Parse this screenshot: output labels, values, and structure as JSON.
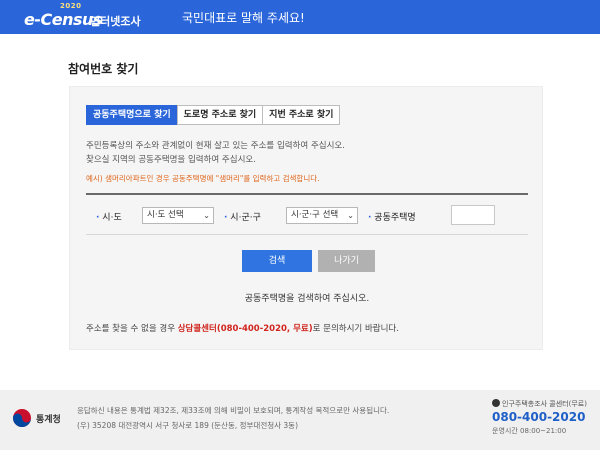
{
  "header": {
    "logo_year": "2020",
    "logo_main": "e-Census",
    "logo_sub": "인터넷조사",
    "slogan": "국민대표로 말해 주세요!"
  },
  "page": {
    "title": "참여번호 찾기"
  },
  "tabs": [
    {
      "label": "공동주택명으로 찾기",
      "active": true
    },
    {
      "label": "도로명 주소로 찾기",
      "active": false
    },
    {
      "label": "지번 주소로 찾기",
      "active": false
    }
  ],
  "description": {
    "line1": "주민등록상의 주소와 관계없이 현재 살고 있는 주소를 입력하여 주십시오.",
    "line2": "찾으실 지역의 공동주택명을 입력하여 주십시오.",
    "example": "예시) 샘머리아파트인 경우 공동주택명에 \"샘머리\"를 입력하고 검색합니다."
  },
  "form": {
    "sido_label": "시·도",
    "sido_value": "시·도 선택",
    "sigungu_label": "시·군·구",
    "sigungu_value": "시·군·구 선택",
    "apt_label": "공동주택명",
    "apt_value": ""
  },
  "buttons": {
    "search": "검색",
    "exit": "나가기"
  },
  "result_message": "공동주택명을 검색하여 주십시오.",
  "help": {
    "prefix": "주소를 찾을 수 없을 경우 ",
    "contact": "상담콜센터(080-400-2020, 무료)",
    "suffix": "로 문의하시기 바랍니다."
  },
  "footer": {
    "org_name": "통계청",
    "notice": "응답하신 내용은 통계법 제32조, 제33조에 의해 비밀이 보호되며, 통계작성 목적으로만 사용됩니다.",
    "address": "(우) 35208 대전광역시 서구 청사로 189 (둔산동, 정부대전청사 3동)",
    "callcenter_label": "인구주택총조사 콜센터(무료)",
    "phone": "080-400-2020",
    "hours": "운영시간 08:00~21:00"
  },
  "colors": {
    "header": "#2a66d9",
    "active_tab": "#2a66d9",
    "search_button": "#2f74e0",
    "exit_button": "#b1b1b1",
    "example_text": "#e0661c",
    "help_highlight": "#d0261f",
    "phone": "#1f5fc8"
  }
}
